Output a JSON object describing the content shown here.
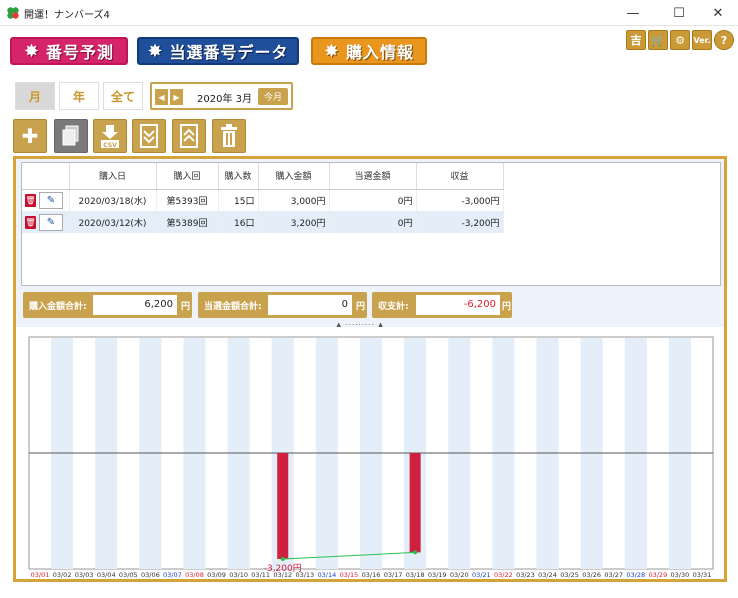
{
  "window": {
    "title": "開運！ナンバーズ4",
    "minimize": "—",
    "maximize": "☐",
    "close": "✕"
  },
  "nav": {
    "predict": "番号予測",
    "winning": "当選番号データ",
    "purchase": "購入情報"
  },
  "tools": {
    "luck": "吉",
    "cart": "🛒",
    "settings": "⚙",
    "version": "Ver.",
    "help": "?"
  },
  "period": {
    "month": "月",
    "year": "年",
    "all": "全て",
    "selected": "月"
  },
  "date": {
    "current": "2020年 3月",
    "today": "今月"
  },
  "table": {
    "headers": [
      "",
      "購入日",
      "購入回",
      "購入数",
      "購入金額",
      "当選金額",
      "収益"
    ],
    "rows": [
      {
        "date": "2020/03/18(水)",
        "round": "第5393回",
        "count": "15口",
        "amount": "3,000円",
        "winning": "0円",
        "profit": "-3,000円"
      },
      {
        "date": "2020/03/12(木)",
        "round": "第5389回",
        "count": "16口",
        "amount": "3,200円",
        "winning": "0円",
        "profit": "-3,200円"
      }
    ]
  },
  "summary": {
    "purchase_label": "購入金額合計:",
    "purchase_value": "6,200",
    "win_label": "当選金額合計:",
    "win_value": "0",
    "balance_label": "収支計:",
    "balance_value": "-6,200",
    "unit": "円"
  },
  "colors": {
    "gold": "#c9a24d",
    "red_bar": "#d0203f",
    "line": "#27c24c",
    "stripe": "#e3eef9",
    "sat": "#1a3fcf",
    "sun": "#d9232d"
  },
  "chart_data": {
    "type": "bar",
    "categories": [
      "03/01",
      "03/02",
      "03/03",
      "03/04",
      "03/05",
      "03/06",
      "03/07",
      "03/08",
      "03/09",
      "03/10",
      "03/11",
      "03/12",
      "03/13",
      "03/14",
      "03/15",
      "03/16",
      "03/17",
      "03/18",
      "03/19",
      "03/20",
      "03/21",
      "03/22",
      "03/23",
      "03/24",
      "03/25",
      "03/26",
      "03/27",
      "03/28",
      "03/29",
      "03/30",
      "03/31"
    ],
    "category_colors": [
      "sun",
      "",
      "",
      "",
      "",
      "",
      "sat",
      "sun",
      "",
      "",
      "",
      "",
      "",
      "sat",
      "sun",
      "",
      "",
      "",
      "",
      "",
      "sat",
      "sun",
      "",
      "",
      "",
      "",
      "",
      "sat",
      "sun",
      "",
      ""
    ],
    "series": [
      {
        "values": [
          0,
          0,
          0,
          0,
          0,
          0,
          0,
          0,
          0,
          0,
          0,
          -3200,
          0,
          0,
          0,
          0,
          0,
          -3000,
          0,
          0,
          0,
          0,
          0,
          0,
          0,
          0,
          0,
          0,
          0,
          0,
          0
        ]
      }
    ],
    "line": [
      {
        "x": "03/12",
        "y": -3200
      },
      {
        "x": "03/18",
        "y": -3000
      }
    ],
    "annotation": {
      "x": "03/12",
      "text": "-3,200円"
    },
    "ylim": [
      -3500,
      3500
    ]
  }
}
